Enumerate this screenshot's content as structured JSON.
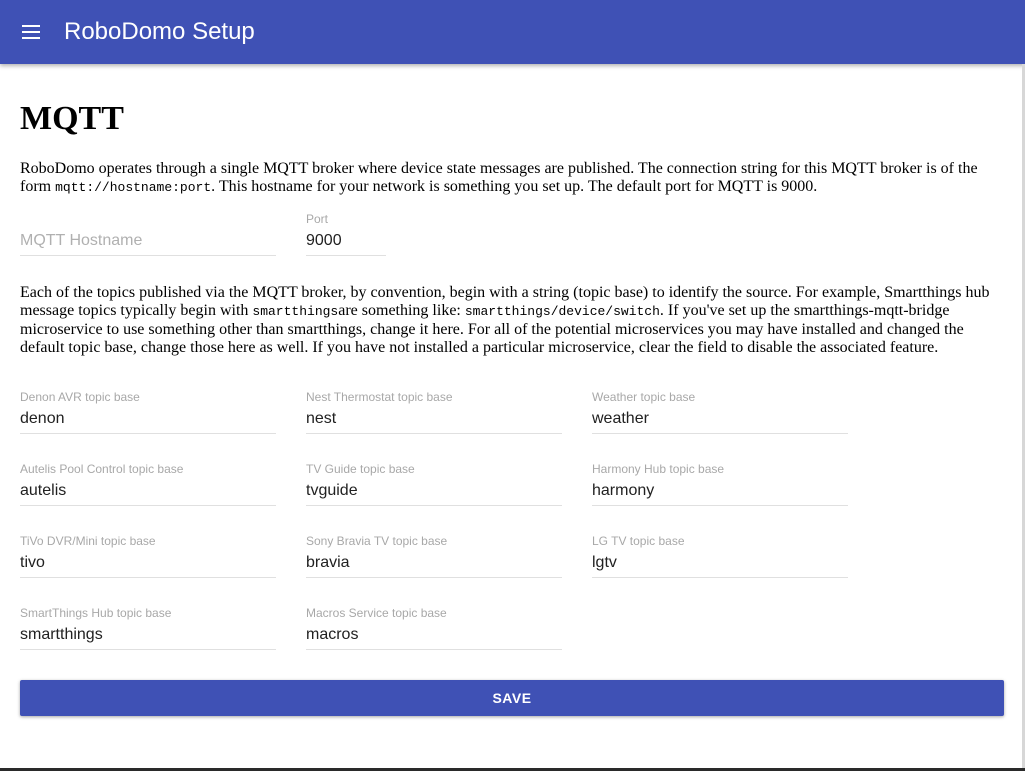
{
  "appbar": {
    "title": "RoboDomo Setup",
    "menu_icon": "menu-icon"
  },
  "section": {
    "title": "MQTT"
  },
  "intro": {
    "t1": "RoboDomo operates through a single MQTT broker where device state messages are published. The connection string for this MQTT broker is of the form ",
    "code": "mqtt://hostname:port",
    "t2": ". This hostname for your network is something you set up. The default port for MQTT is 9000."
  },
  "hostname": {
    "placeholder": "MQTT Hostname",
    "value": ""
  },
  "port": {
    "label": "Port",
    "value": "9000"
  },
  "topics_para": {
    "t1": "Each of the topics published via the MQTT broker, by convention, begin with a string (topic base) to identify the source. For example, Smartthings hub message topics typically begin with ",
    "code1": "smartthings",
    "t2": "are something like: ",
    "code2": "smartthings/device/switch",
    "t3": ". If you've set up the smartthings-mqtt-bridge microservice to use something other than smartthings, change it here. For all of the potential microservices you may have installed and changed the default topic base, change those here as well. If you have not installed a particular microservice, clear the field to disable the associated feature."
  },
  "topics": {
    "denon": {
      "label": "Denon AVR topic base",
      "value": "denon"
    },
    "nest": {
      "label": "Nest Thermostat topic base",
      "value": "nest"
    },
    "weather": {
      "label": "Weather topic base",
      "value": "weather"
    },
    "autelis": {
      "label": "Autelis Pool Control topic base",
      "value": "autelis"
    },
    "tvguide": {
      "label": "TV Guide topic base",
      "value": "tvguide"
    },
    "harmony": {
      "label": "Harmony Hub topic base",
      "value": "harmony"
    },
    "tivo": {
      "label": "TiVo DVR/Mini topic base",
      "value": "tivo"
    },
    "bravia": {
      "label": "Sony Bravia TV topic base",
      "value": "bravia"
    },
    "lgtv": {
      "label": "LG TV topic base",
      "value": "lgtv"
    },
    "smartthings": {
      "label": "SmartThings Hub topic base",
      "value": "smartthings"
    },
    "macros": {
      "label": "Macros Service topic base",
      "value": "macros"
    }
  },
  "save": {
    "label": "SAVE"
  },
  "colors": {
    "primary": "#3f51b5",
    "label": "#a8a8a8",
    "underline": "#e0e0e0"
  }
}
